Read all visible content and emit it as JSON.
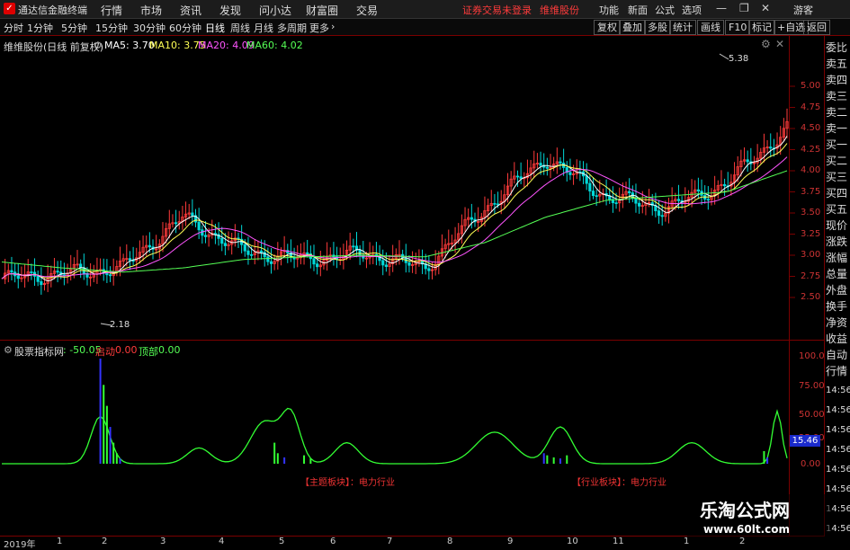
{
  "app": {
    "title": "通达信金融终端"
  },
  "menu": {
    "items": [
      "行情",
      "市场",
      "资讯",
      "发现",
      "问小达",
      "财富圈",
      "交易"
    ],
    "warning": "证券交易未登录",
    "stock_name_top": "维维股份",
    "right": [
      "功能",
      "新面",
      "公式",
      "选项"
    ],
    "login": "游客"
  },
  "periods": {
    "items": [
      "分时",
      "1分钟",
      "5分钟",
      "15分钟",
      "30分钟",
      "60分钟",
      "日线",
      "周线",
      "月线",
      "多周期",
      "更多"
    ],
    "active": "日线",
    "tools": [
      "复权",
      "叠加",
      "多股",
      "统计",
      "画线",
      "F10",
      "标记",
      "+自选",
      "返回"
    ]
  },
  "chart_header": {
    "title": "维维股份(日线 前复权)",
    "ma5": "MA5: 3.70",
    "ma10": "MA10: 3.75",
    "ma20": "MA20: 4.09",
    "ma60": "MA60: 4.02"
  },
  "price_axis": [
    "5.00",
    "4.75",
    "4.50",
    "4.25",
    "4.00",
    "3.75",
    "3.50",
    "3.25",
    "3.00",
    "2.75",
    "2.50"
  ],
  "annotations": {
    "high": "5.38",
    "low": "2.18"
  },
  "right_panel": [
    "委比",
    "卖五",
    "卖四",
    "卖三",
    "卖二",
    "卖一",
    "买一",
    "买二",
    "买三",
    "买四",
    "买五",
    "现价",
    "涨跌",
    "涨幅",
    "总量",
    "外盘",
    "换手",
    "净资",
    "收益"
  ],
  "right_panel_bottom": [
    "自动",
    "行情"
  ],
  "indicator": {
    "name": "股票指标网",
    "value": ": -50.05",
    "start_label": "启动",
    "start_value": "0.00",
    "top_label": "顶部",
    "top_value": "0.00",
    "axis": [
      "100.0",
      "75.00",
      "50.00",
      "25.00",
      "0.00"
    ],
    "current": "15.46",
    "sector_labels": [
      "【主题板块】：电力行业",
      "【行业板块】：电力行业"
    ]
  },
  "time_col": [
    "14:56",
    "14:56",
    "14:56",
    "14:56",
    "14:56",
    "14:56",
    "14:56",
    "14:56"
  ],
  "x_axis": [
    "2019年",
    "1",
    "2",
    "3",
    "4",
    "5",
    "6",
    "7",
    "8",
    "9",
    "10",
    "11",
    "1",
    "2"
  ],
  "watermark": {
    "title": "乐淘公式网",
    "url": "www.60lt.com"
  },
  "colors": {
    "up": "#ff3b3b",
    "down": "#00d8d8",
    "ma5": "#ffffff",
    "ma10": "#ffff55",
    "ma20": "#ff55ff",
    "ma60": "#55ff55",
    "indicator": "#33ff33",
    "bar": "#3333ff"
  },
  "chart_data": {
    "type": "line",
    "title": "维维股份(日线 前复权)",
    "xlabel": "",
    "ylabel": "",
    "ylim": [
      2.3,
      5.5
    ],
    "x": [
      "2019-01",
      "2019-02",
      "2019-03",
      "2019-04",
      "2019-05",
      "2019-06",
      "2019-07",
      "2019-08",
      "2019-09",
      "2019-10",
      "2019-11",
      "2019-12",
      "2020-01",
      "2020-02"
    ],
    "series": [
      {
        "name": "MA5",
        "values": [
          2.72,
          2.78,
          2.85,
          3.45,
          3.05,
          2.95,
          3.02,
          2.85,
          3.55,
          4.15,
          3.7,
          3.55,
          3.85,
          4.5
        ]
      },
      {
        "name": "MA60",
        "values": [
          2.92,
          2.85,
          2.8,
          2.85,
          2.95,
          2.98,
          3.0,
          2.98,
          3.15,
          3.45,
          3.65,
          3.7,
          3.75,
          4.0
        ]
      }
    ],
    "annotations": [
      {
        "label": "5.38",
        "value": 5.38
      },
      {
        "label": "2.18",
        "value": 2.18
      }
    ]
  }
}
